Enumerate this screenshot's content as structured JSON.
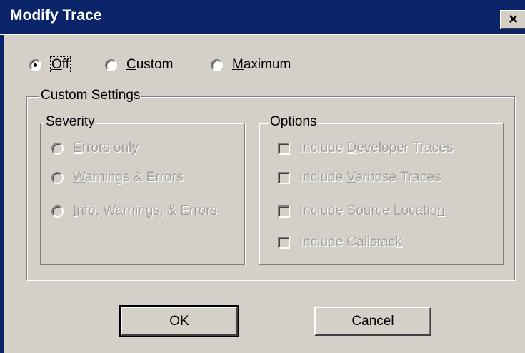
{
  "window": {
    "title": "Modify Trace",
    "close_glyph": "×"
  },
  "mode": {
    "options": [
      {
        "pre": "",
        "key": "O",
        "post": "ff",
        "selected": true
      },
      {
        "pre": "",
        "key": "C",
        "post": "ustom",
        "selected": false
      },
      {
        "pre": "",
        "key": "M",
        "post": "aximum",
        "selected": false
      }
    ]
  },
  "custom_settings": {
    "title": "Custom Settings",
    "severity": {
      "title": "Severity",
      "options": [
        {
          "pre": "",
          "key": "E",
          "post": "rrors only"
        },
        {
          "pre": "",
          "key": "W",
          "post": "arnings & Errors"
        },
        {
          "pre": "",
          "key": "I",
          "post": "nfo, Warnings, & Errors"
        }
      ]
    },
    "options": {
      "title": "Options",
      "items": [
        {
          "pre": "Include ",
          "key": "D",
          "post": "eveloper Traces"
        },
        {
          "pre": "Include ",
          "key": "V",
          "post": "erbose Traces"
        },
        {
          "pre": "Include Source Locatio",
          "key": "n",
          "post": ""
        },
        {
          "pre": "Include Callstac",
          "key": "k",
          "post": ""
        }
      ]
    }
  },
  "buttons": {
    "ok": "OK",
    "cancel": "Cancel"
  }
}
